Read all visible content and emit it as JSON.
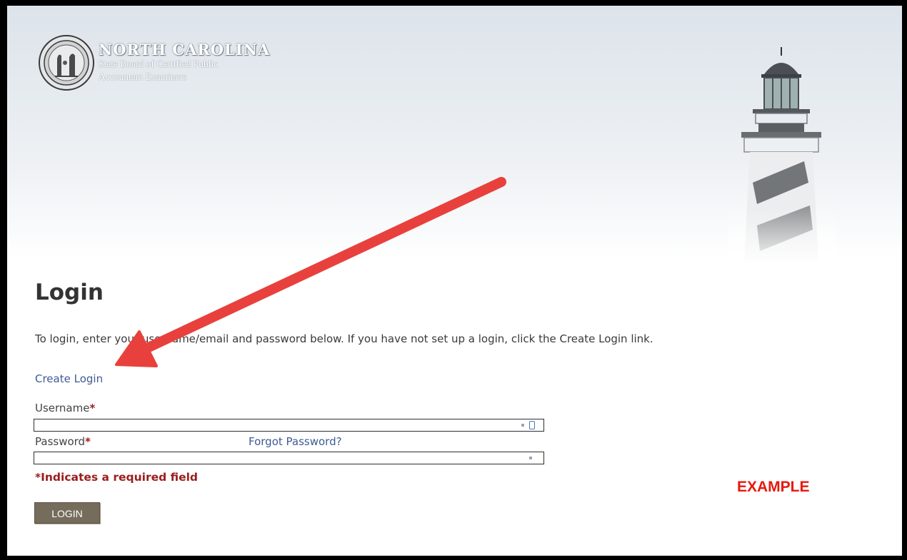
{
  "header": {
    "title": "NORTH CAROLINA",
    "subtitle_line1": "State Board of Certified Public",
    "subtitle_line2": "Accountant Examiners",
    "seal_icon": "nc-state-seal-icon",
    "banner_image": "lighthouse-icon"
  },
  "login": {
    "heading": "Login",
    "intro": "To login, enter your username/email and password below. If you have not set up a login, click the Create Login link.",
    "create_login_link": "Create Login",
    "username_label": "Username",
    "password_label": "Password",
    "required_marker": "*",
    "forgot_password_link": "Forgot Password?",
    "username_value": "",
    "password_value": "",
    "required_note": "*Indicates a required field",
    "submit_label": "LOGIN"
  },
  "annotation": {
    "watermark": "EXAMPLE",
    "arrow_icon": "red-arrow-icon",
    "arrow_color": "#e8413d"
  },
  "colors": {
    "link": "#3f5a95",
    "required": "#9a1d1d",
    "button": "#756c5c",
    "example": "#e8180e"
  }
}
